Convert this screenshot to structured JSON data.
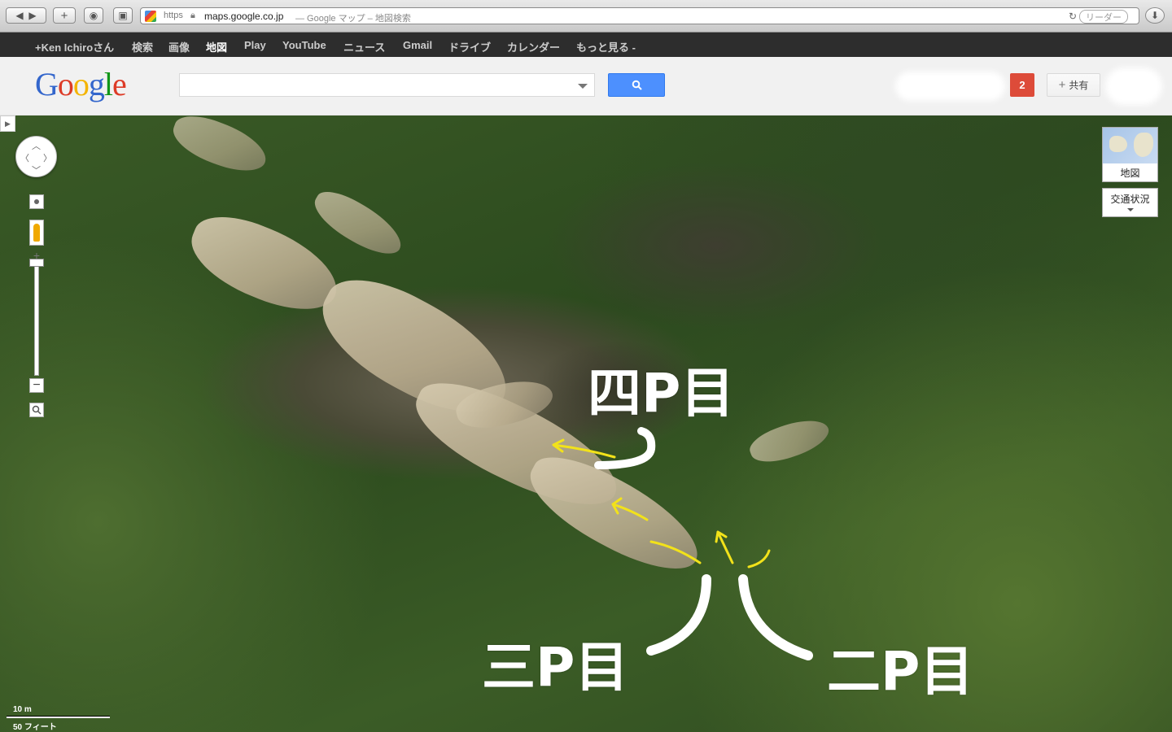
{
  "browser": {
    "https_label": "https",
    "host": "maps.google.co.jp",
    "title": "— Google マップ – 地図検索",
    "reader_label": "リーダー"
  },
  "gbar": {
    "items": [
      "+Ken Ichiroさん",
      "検索",
      "画像",
      "地図",
      "Play",
      "YouTube",
      "ニュース",
      "Gmail",
      "ドライブ",
      "カレンダー",
      "もっと見る -"
    ],
    "active_index": 3
  },
  "header": {
    "logo_letters": [
      "G",
      "o",
      "o",
      "g",
      "l",
      "e"
    ],
    "logo_colors": [
      "#3366cc",
      "#dd3b27",
      "#f4b400",
      "#3366cc",
      "#109618",
      "#dd3b27"
    ],
    "search_placeholder": "",
    "notifications_count": "2",
    "share_label": "共有"
  },
  "map": {
    "maptype_label": "地図",
    "traffic_label": "交通状況",
    "scale_metric": "10 m",
    "scale_imperial": "50 フィート",
    "annotations": {
      "pitch4": "四P目",
      "pitch3": "三P目",
      "pitch2": "二P目"
    },
    "arrow_color": "#f2e21a"
  }
}
